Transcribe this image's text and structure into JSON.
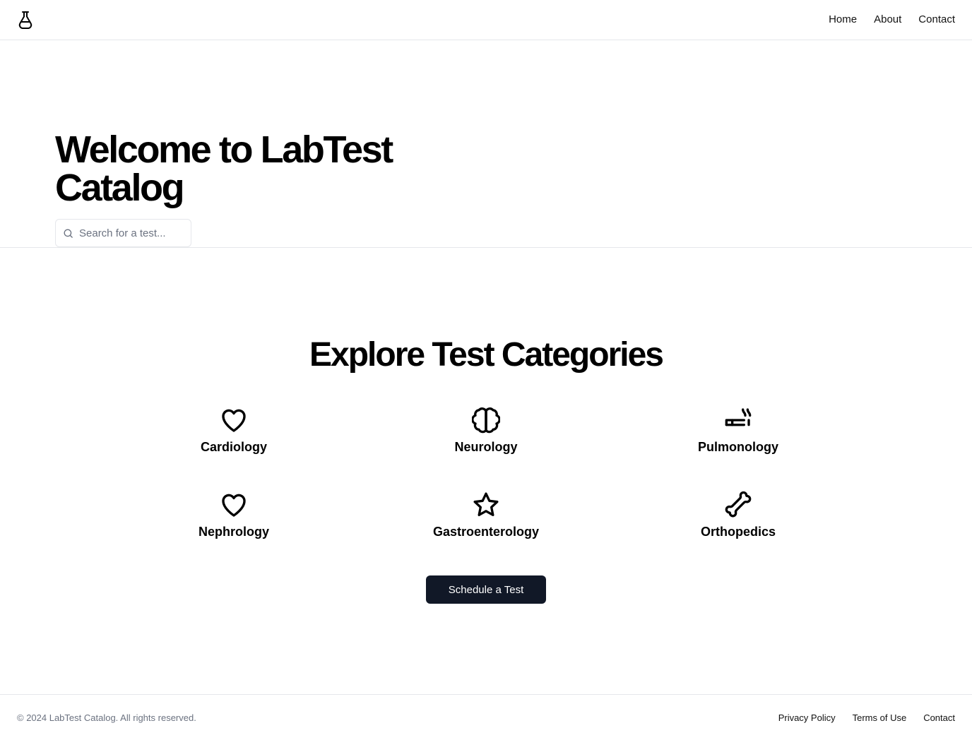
{
  "header": {
    "logo_icon": "flask-icon",
    "nav": [
      {
        "label": "Home"
      },
      {
        "label": "About"
      },
      {
        "label": "Contact"
      }
    ]
  },
  "hero": {
    "title": "Welcome to LabTest Catalog",
    "search": {
      "icon": "search-icon",
      "placeholder": "Search for a test...",
      "value": ""
    }
  },
  "categories_section": {
    "title": "Explore Test Categories",
    "items": [
      {
        "label": "Cardiology",
        "icon": "heart-icon"
      },
      {
        "label": "Neurology",
        "icon": "brain-icon"
      },
      {
        "label": "Pulmonology",
        "icon": "cigarette-icon"
      },
      {
        "label": "Nephrology",
        "icon": "heart-icon"
      },
      {
        "label": "Gastroenterology",
        "icon": "star-icon"
      },
      {
        "label": "Orthopedics",
        "icon": "bone-icon"
      }
    ],
    "cta_label": "Schedule a Test"
  },
  "footer": {
    "copyright": "© 2024 LabTest Catalog. All rights reserved.",
    "links": [
      {
        "label": "Privacy Policy"
      },
      {
        "label": "Terms of Use"
      },
      {
        "label": "Contact"
      }
    ]
  },
  "colors": {
    "primary_button": "#111827",
    "border": "#e5e7eb",
    "muted_text": "#6b7280"
  }
}
